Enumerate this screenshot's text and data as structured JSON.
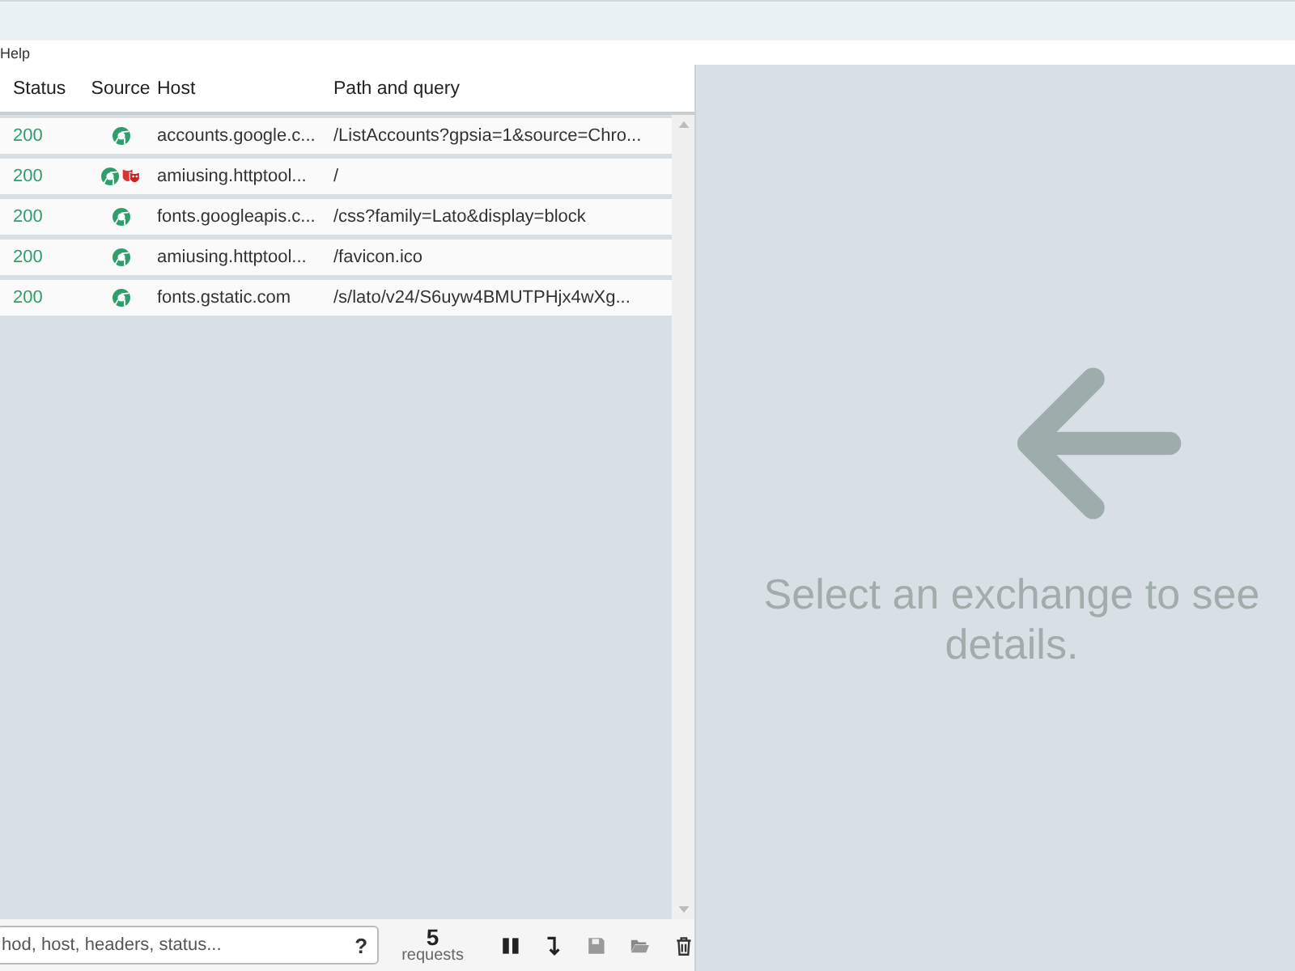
{
  "menu": {
    "items": [
      "Help"
    ]
  },
  "table": {
    "columns": [
      "Status",
      "Source",
      "Host",
      "Path and query"
    ],
    "rows": [
      {
        "status": "200",
        "sources": [
          {
            "kind": "browser"
          }
        ],
        "host": "accounts.google.c...",
        "path": "/ListAccounts?gpsia=1&source=Chro..."
      },
      {
        "status": "200",
        "sources": [
          {
            "kind": "browser"
          },
          {
            "kind": "mask"
          }
        ],
        "host": "amiusing.httptool...",
        "path": "/"
      },
      {
        "status": "200",
        "sources": [
          {
            "kind": "browser"
          }
        ],
        "host": "fonts.googleapis.c...",
        "path": "/css?family=Lato&display=block"
      },
      {
        "status": "200",
        "sources": [
          {
            "kind": "browser"
          }
        ],
        "host": "amiusing.httptool...",
        "path": "/favicon.ico"
      },
      {
        "status": "200",
        "sources": [
          {
            "kind": "browser"
          }
        ],
        "host": "fonts.gstatic.com",
        "path": "/s/lato/v24/S6uyw4BMUTPHjx4wXg..."
      }
    ]
  },
  "footer": {
    "filter": {
      "placeholder": "hod, host, headers, status..."
    },
    "help": "?",
    "count": "5",
    "count_label": "requests"
  },
  "details": {
    "message": "Select an exchange to see details."
  }
}
